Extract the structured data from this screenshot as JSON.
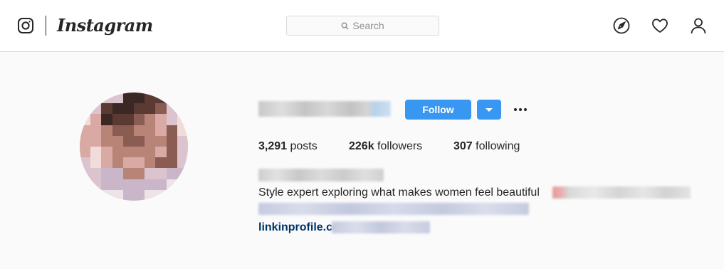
{
  "nav": {
    "brand": "Instagram",
    "search": {
      "placeholder": "Search",
      "icon": "search-icon"
    },
    "icons": [
      "instagram-glyph-icon",
      "compass-icon",
      "heart-icon",
      "person-icon"
    ]
  },
  "profile": {
    "follow_label": "Follow",
    "stats": {
      "posts_count": "3,291",
      "posts_label": " posts",
      "followers_count": "226k",
      "followers_label": " followers",
      "following_count": "307",
      "following_label": " following"
    },
    "bio": "Style expert exploring what makes women feel beautiful",
    "link_text": "linkinprofile.co"
  },
  "colors": {
    "accent": "#3897f0",
    "link": "#003569",
    "background": "#fafafa",
    "text": "#262626",
    "muted": "#8e8e8e",
    "border": "#dbdbdb"
  }
}
